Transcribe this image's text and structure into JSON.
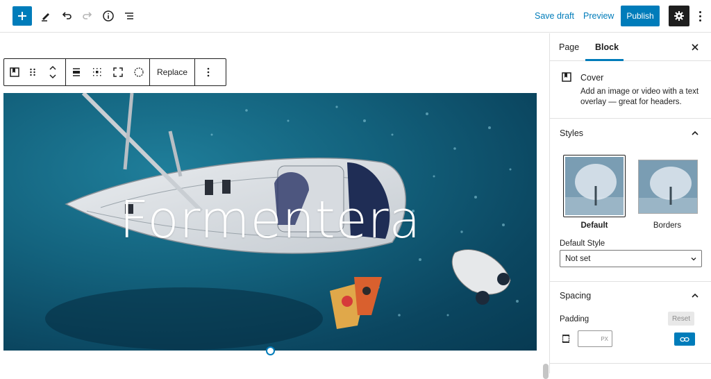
{
  "topbar": {
    "save_draft": "Save draft",
    "preview": "Preview",
    "publish": "Publish",
    "icons": [
      "plus-icon",
      "pencil-icon",
      "undo-icon",
      "redo-icon",
      "info-icon",
      "list-view-icon",
      "gear-icon",
      "kebab-icon"
    ]
  },
  "block_toolbar": {
    "replace_label": "Replace",
    "icons": [
      "cover-block-icon",
      "drag-handle-icon",
      "move-up-down-icon",
      "align-icon",
      "position-icon",
      "fullheight-icon",
      "circle-icon",
      "more-options-icon"
    ]
  },
  "cover": {
    "title": "Formentera"
  },
  "sidebar": {
    "tabs": [
      {
        "label": "Page",
        "active": false
      },
      {
        "label": "Block",
        "active": true
      }
    ],
    "block": {
      "name": "Cover",
      "description": "Add an image or video with a text overlay — great for headers."
    },
    "styles": {
      "title": "Styles",
      "options": [
        {
          "label": "Default",
          "selected": true
        },
        {
          "label": "Borders",
          "selected": false
        }
      ],
      "default_style_label": "Default Style",
      "default_style_value": "Not set"
    },
    "spacing": {
      "title": "Spacing",
      "padding_label": "Padding",
      "reset_label": "Reset",
      "unit": "PX"
    }
  },
  "colors": {
    "accent": "#007cba",
    "dark": "#1e1e1e",
    "border": "#e0e0e0"
  }
}
